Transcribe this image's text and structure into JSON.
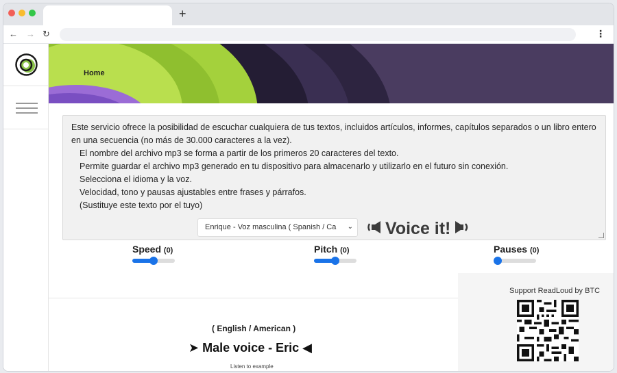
{
  "browser": {
    "new_tab_symbol": "+",
    "back_icon": "arrow-left-icon",
    "forward_icon": "arrow-right-icon",
    "reload_icon": "reload-icon",
    "menu_icon": "kebab-menu-icon"
  },
  "header": {
    "home_label": "Home",
    "colors": {
      "purple": "#4a3c60",
      "green": "#9fcc3a",
      "violet": "#9b6cd6"
    }
  },
  "textbox": {
    "lines": [
      "Este servicio ofrece la posibilidad de escuchar cualquiera de tus textos, incluidos artículos, informes, capítulos separados o un libro entero en una secuencia (no más de 30.000 caracteres a la vez).",
      "El nombre del archivo mp3 se forma a partir de los primeros 20 caracteres del texto.",
      "Permite guardar el archivo mp3 generado en tu dispositivo para almacenarlo y utilizarlo en el futuro sin conexión.",
      "Selecciona el idioma y la voz.",
      "Velocidad, tono y pausas ajustables entre frases y párrafos.",
      "(Sustituye este texto por el tuyo)"
    ]
  },
  "voice_select": {
    "value": "Enrique - Voz masculina ( Spanish / Ca"
  },
  "voice_button": {
    "label": "Voice it!"
  },
  "controls": {
    "speed": {
      "label": "Speed",
      "value": "(0)",
      "level": 0.5
    },
    "pitch": {
      "label": "Pitch",
      "value": "(0)",
      "level": 0.5
    },
    "pauses": {
      "label": "Pauses",
      "value": "(0)",
      "level": 0.0
    }
  },
  "support": {
    "text": "Support ReadLoud by BTC"
  },
  "example": {
    "language": "( English / American )",
    "voice": "➤ Male voice - Eric ◀",
    "listen": "Listen to example"
  },
  "accent_color": "#1a73e8"
}
